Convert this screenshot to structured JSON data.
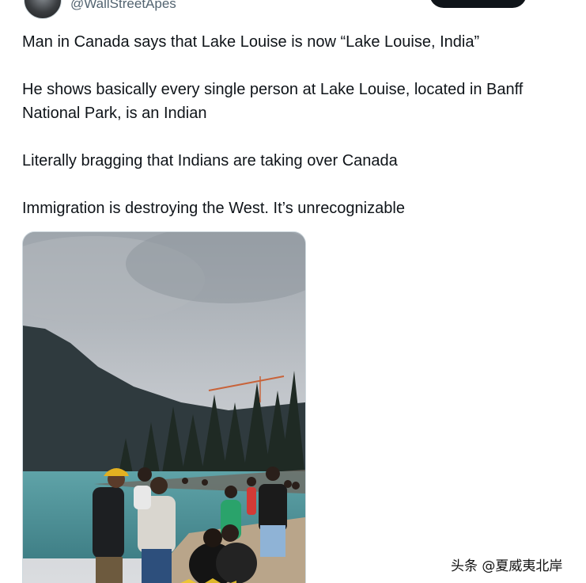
{
  "tweet": {
    "handle": "@WallStreetApes",
    "follow_label": "",
    "paragraphs": [
      "Man in Canada says that Lake Louise is now “Lake Louise, India”",
      "He shows basically every single person at Lake Louise, located in Banff National Park, is an Indian",
      "Literally bragging that Indians are taking over Canada",
      "Immigration is destroying the West. It’s unrecognizable"
    ]
  },
  "media": {
    "kind": "video-still",
    "scene": "lake-with-crowd"
  },
  "watermark": {
    "text": "头条 @夏威夷北岸"
  },
  "colors": {
    "text": "#0f1419",
    "secondary": "#536471",
    "border": "#cfd9de",
    "button": "#0f1419"
  }
}
